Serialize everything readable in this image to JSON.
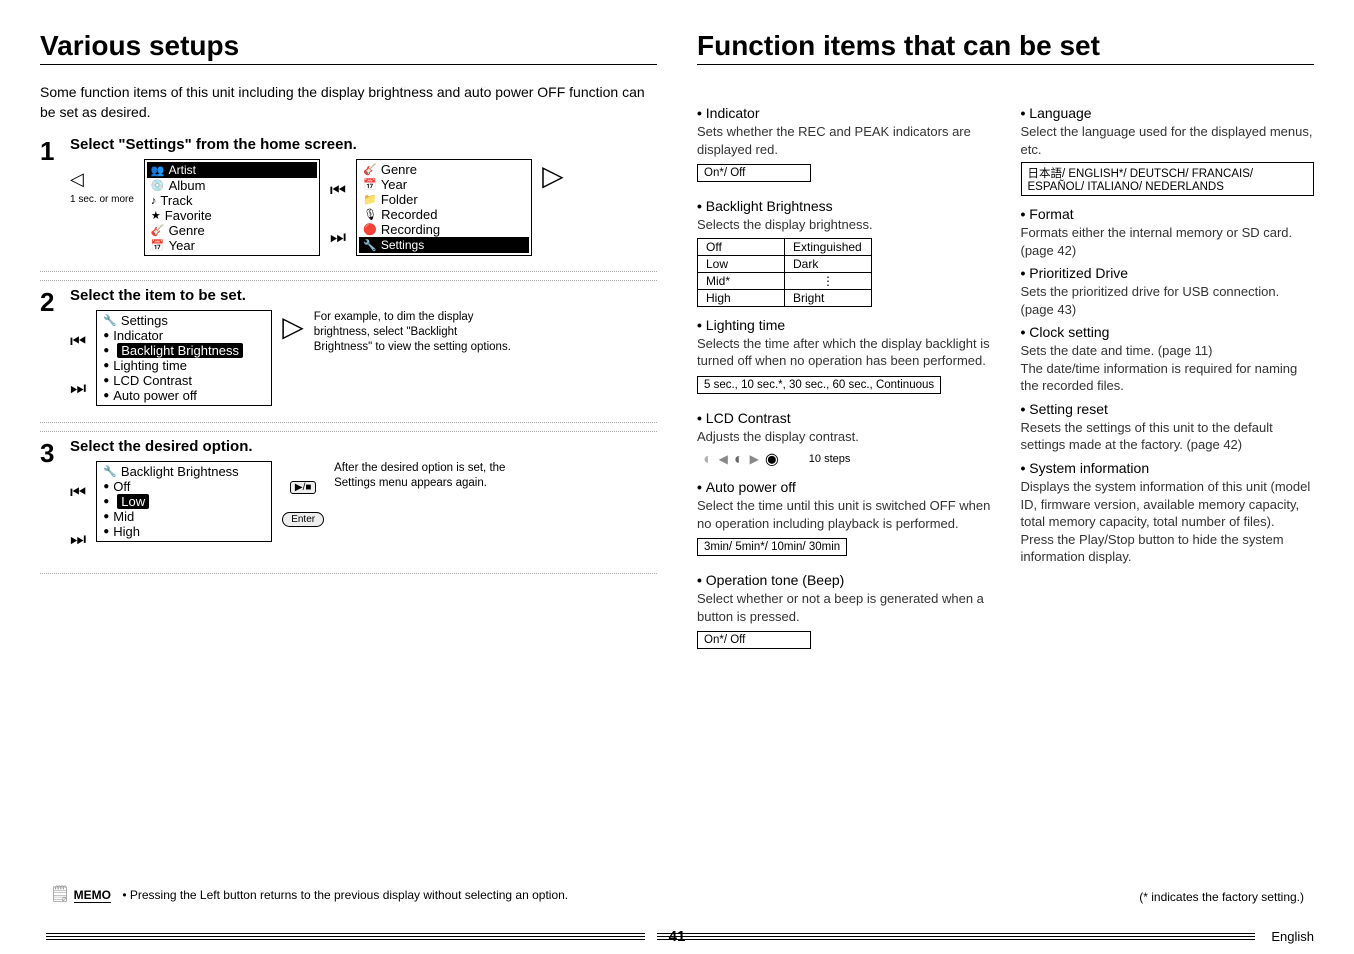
{
  "left": {
    "title": "Various setups",
    "intro": "Some function items of this unit including the display brightness and auto power OFF function can be set as desired.",
    "steps": [
      {
        "num": "1",
        "title": "Select \"Settings\" from the home screen.",
        "nav_note": "1 sec. or more",
        "screen_a": [
          "Artist",
          "Album",
          "Track",
          "Favorite",
          "Genre",
          "Year"
        ],
        "screen_b": [
          "Genre",
          "Year",
          "Folder",
          "Recorded",
          "Recording",
          "Settings"
        ]
      },
      {
        "num": "2",
        "title": "Select the item to be set.",
        "screen_header": "Settings",
        "screen_items": [
          "Indicator",
          "Backlight Brightness",
          "Lighting time",
          "LCD Contrast",
          "Auto power off"
        ],
        "selected_index": 1,
        "aside": "For example, to dim the display brightness, select \"Backlight Brightness\" to view the setting options."
      },
      {
        "num": "3",
        "title": "Select the desired option.",
        "screen_header": "Backlight Brightness",
        "screen_items": [
          "Off",
          "Low",
          "Mid",
          "High"
        ],
        "selected_index": 1,
        "aside": "After the desired option is set, the Settings menu appears again.",
        "enter_label": "Enter"
      }
    ],
    "memo_label": "MEMO",
    "memo_text": "• Pressing the Left button returns to the previous display without selecting an option."
  },
  "right": {
    "title": "Function items that can be set",
    "col1": {
      "indicator": {
        "h": "Indicator",
        "d": "Sets whether the REC and PEAK indicators are displayed red.",
        "v": "On*/ Off"
      },
      "backlight": {
        "h": "Backlight Brightness",
        "d": "Selects the display brightness.",
        "table": [
          [
            "Off",
            "Extinguished"
          ],
          [
            "Low",
            "Dark"
          ],
          [
            "Mid*",
            "⋮"
          ],
          [
            "High",
            "Bright"
          ]
        ]
      },
      "lighting": {
        "h": "Lighting time",
        "d": "Selects the time after which the display backlight is turned off when no operation has been performed.",
        "v": "5 sec., 10 sec.*, 30 sec., 60 sec., Continuous"
      },
      "lcd": {
        "h": "LCD Contrast",
        "d": "Adjusts the display contrast.",
        "steps": "10 steps"
      },
      "autopower": {
        "h": "Auto power off",
        "d": "Select the time until this unit is switched OFF when no operation including playback is performed.",
        "v": "3min/ 5min*/ 10min/ 30min"
      },
      "beep": {
        "h": "Operation tone (Beep)",
        "d": "Select whether or not a beep is generated when a button is pressed.",
        "v": "On*/ Off"
      }
    },
    "col2": {
      "language": {
        "h": "Language",
        "d": "Select the language used for the displayed menus, etc.",
        "v": "日本語/ ENGLISH*/ DEUTSCH/ FRANCAIS/ ESPAÑOL/ ITALIANO/ NEDERLANDS"
      },
      "format": {
        "h": "Format",
        "d": "Formats either the internal memory or SD card.  (page 42)"
      },
      "drive": {
        "h": "Prioritized Drive",
        "d": "Sets the prioritized drive for USB connection.  (page 43)"
      },
      "clock": {
        "h": "Clock setting",
        "d": "Sets the date and time.  (page 11)\nThe date/time information is required for naming the recorded files."
      },
      "reset": {
        "h": "Setting reset",
        "d": "Resets the settings of this unit to the default settings made at the factory.  (page 42)"
      },
      "sysinfo": {
        "h": "System information",
        "d": "Displays the system information of this unit (model ID, firmware version, available memory capacity, total memory capacity, total number of files).\nPress the Play/Stop button to hide the system information display."
      }
    },
    "factory_note": "(* indicates the factory setting.)"
  },
  "footer": {
    "page": "41",
    "lang": "English"
  }
}
